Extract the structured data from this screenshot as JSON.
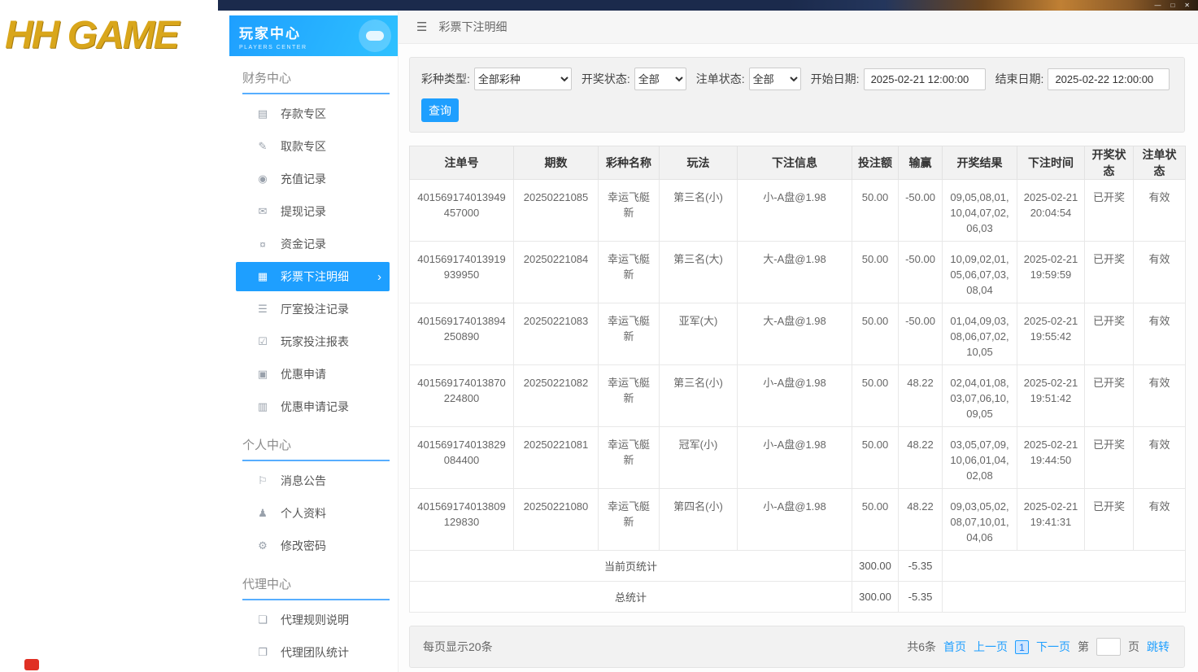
{
  "window": {
    "controls": {
      "minimize": "—",
      "maximize": "□",
      "close": "✕"
    }
  },
  "brand": {
    "logo_text": "HH GAME"
  },
  "sidebar": {
    "header": {
      "title": "玩家中心",
      "subtitle": "PLAYERS CENTER"
    },
    "sections": [
      {
        "title": "财务中心",
        "items": [
          {
            "id": "deposit-zone",
            "label": "存款专区",
            "icon": "deposit-icon",
            "glyph": "▤"
          },
          {
            "id": "withdraw-zone",
            "label": "取款专区",
            "icon": "withdraw-icon",
            "glyph": "✎"
          },
          {
            "id": "recharge-records",
            "label": "充值记录",
            "icon": "recharge-record-icon",
            "glyph": "◉"
          },
          {
            "id": "cashout-records",
            "label": "提现记录",
            "icon": "cashout-record-icon",
            "glyph": "✉"
          },
          {
            "id": "fund-records",
            "label": "资金记录",
            "icon": "fund-record-icon",
            "glyph": "¤"
          },
          {
            "id": "lottery-bet-details",
            "label": "彩票下注明细",
            "icon": "lottery-bet-icon",
            "glyph": "▦",
            "active": true
          },
          {
            "id": "hall-bet-records",
            "label": "厅室投注记录",
            "icon": "hall-bet-icon",
            "glyph": "☰"
          },
          {
            "id": "player-bet-report",
            "label": "玩家投注报表",
            "icon": "report-icon",
            "glyph": "☑"
          },
          {
            "id": "promo-apply",
            "label": "优惠申请",
            "icon": "promo-icon",
            "glyph": "▣"
          },
          {
            "id": "promo-apply-records",
            "label": "优惠申请记录",
            "icon": "promo-record-icon",
            "glyph": "▥"
          }
        ]
      },
      {
        "title": "个人中心",
        "items": [
          {
            "id": "messages",
            "label": "消息公告",
            "icon": "bell-icon",
            "glyph": "⚐"
          },
          {
            "id": "profile",
            "label": "个人资料",
            "icon": "user-icon",
            "glyph": "♟"
          },
          {
            "id": "change-password",
            "label": "修改密码",
            "icon": "gear-icon",
            "glyph": "⚙"
          }
        ]
      },
      {
        "title": "代理中心",
        "items": [
          {
            "id": "agent-rules",
            "label": "代理规则说明",
            "icon": "document-icon",
            "glyph": "❏"
          },
          {
            "id": "agent-team-stats",
            "label": "代理团队统计",
            "icon": "stats-icon",
            "glyph": "❐"
          }
        ]
      }
    ]
  },
  "topbar": {
    "title": "彩票下注明细"
  },
  "filters": {
    "lottery_type_label": "彩种类型:",
    "lottery_type_value": "全部彩种",
    "draw_status_label": "开奖状态:",
    "draw_status_value": "全部",
    "bet_status_label": "注单状态:",
    "bet_status_value": "全部",
    "start_date_label": "开始日期:",
    "start_date_value": "2025-02-21 12:00:00",
    "end_date_label": "结束日期:",
    "end_date_value": "2025-02-22 12:00:00",
    "search_button": "查询"
  },
  "table": {
    "headers": [
      "注单号",
      "期数",
      "彩种名称",
      "玩法",
      "下注信息",
      "投注额",
      "输赢",
      "开奖结果",
      "下注时间",
      "开奖状态",
      "注单状态"
    ],
    "rows": [
      [
        "401569174013949457000",
        "20250221085",
        "幸运飞艇新",
        "第三名(小)",
        "小-A盘@1.98",
        "50.00",
        "-50.00",
        "09,05,08,01,10,04,07,02,06,03",
        "2025-02-21 20:04:54",
        "已开奖",
        "有效"
      ],
      [
        "401569174013919939950",
        "20250221084",
        "幸运飞艇新",
        "第三名(大)",
        "大-A盘@1.98",
        "50.00",
        "-50.00",
        "10,09,02,01,05,06,07,03,08,04",
        "2025-02-21 19:59:59",
        "已开奖",
        "有效"
      ],
      [
        "401569174013894250890",
        "20250221083",
        "幸运飞艇新",
        "亚军(大)",
        "大-A盘@1.98",
        "50.00",
        "-50.00",
        "01,04,09,03,08,06,07,02,10,05",
        "2025-02-21 19:55:42",
        "已开奖",
        "有效"
      ],
      [
        "401569174013870224800",
        "20250221082",
        "幸运飞艇新",
        "第三名(小)",
        "小-A盘@1.98",
        "50.00",
        "48.22",
        "02,04,01,08,03,07,06,10,09,05",
        "2025-02-21 19:51:42",
        "已开奖",
        "有效"
      ],
      [
        "401569174013829084400",
        "20250221081",
        "幸运飞艇新",
        "冠军(小)",
        "小-A盘@1.98",
        "50.00",
        "48.22",
        "03,05,07,09,10,06,01,04,02,08",
        "2025-02-21 19:44:50",
        "已开奖",
        "有效"
      ],
      [
        "401569174013809129830",
        "20250221080",
        "幸运飞艇新",
        "第四名(小)",
        "小-A盘@1.98",
        "50.00",
        "48.22",
        "09,03,05,02,08,07,10,01,04,06",
        "2025-02-21 19:41:31",
        "已开奖",
        "有效"
      ]
    ],
    "summary_rows": [
      {
        "label": "当前页统计",
        "bet_total": "300.00",
        "win_loss_total": "-5.35"
      },
      {
        "label": "总统计",
        "bet_total": "300.00",
        "win_loss_total": "-5.35"
      }
    ]
  },
  "pagination": {
    "page_size_text": "每页显示20条",
    "total_text": "共6条",
    "first_label": "首页",
    "prev_label": "上一页",
    "current_page": "1",
    "next_label": "下一页",
    "jump_prefix": "第",
    "jump_suffix": "页",
    "jump_button_label": "跳转",
    "jump_input_value": ""
  },
  "colors": {
    "accent": "#1e9fff",
    "titlebar": "#1b2a4c",
    "logo_gold": "#d9a61b"
  }
}
